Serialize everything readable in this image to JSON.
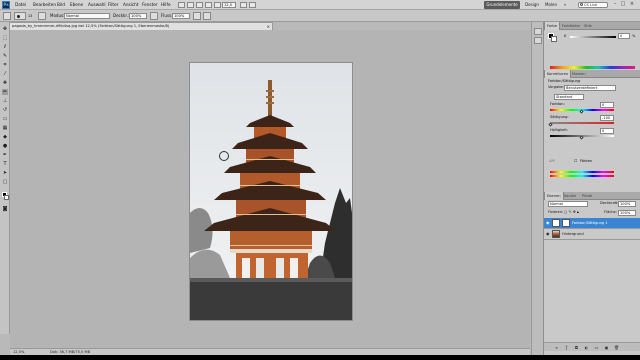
{
  "app": {
    "logo": "Ps"
  },
  "menu": {
    "items": [
      "Datei",
      "Bearbeiten",
      "Bild",
      "Ebene",
      "Auswahl",
      "Filter",
      "Ansicht",
      "Fenster",
      "Hilfe"
    ],
    "zoom": "12,5",
    "workspaces": {
      "active": "Grundelemente",
      "design": "Design",
      "paint": "Malen"
    },
    "search_placeholder": "CS Live"
  },
  "options_bar": {
    "mode_label": "Modus:",
    "mode_value": "Normal",
    "opacity_label": "Deckkr.:",
    "opacity_value": "100%",
    "flow_label": "Fluss:",
    "flow_value": "100%",
    "brush_size": "13"
  },
  "document": {
    "tab_title": "pagoda_by_hmmmmm-d9ib4sq.jpg bei 12,5% (Farbton/Sättigung 1, Ebenenmaske/8)",
    "close": "×"
  },
  "status": {
    "zoom": "12,5%",
    "doc_info": "Dok: 36,7 MB/75,5 MB"
  },
  "color_panel": {
    "tabs": [
      "Farbe",
      "Farbfelder",
      "Stile"
    ],
    "k_label": "K",
    "k_value": "0",
    "percent": "%"
  },
  "adjustments_panel": {
    "tabs": [
      "Korrekturen",
      "Masken"
    ],
    "title": "Farbton/Sättigung",
    "preset_label": "Vorgabe:",
    "preset_value": "Benutzerdefiniert",
    "channel_value": "Standard",
    "hue_label": "Farbton:",
    "hue_value": "0",
    "saturation_label": "Sättigung:",
    "saturation_value": "-100",
    "lightness_label": "Helligkeit:",
    "lightness_value": "0",
    "colorize_label": "Färben"
  },
  "layers_panel": {
    "tabs": [
      "Ebenen",
      "Kanäle",
      "Pfade"
    ],
    "blend_mode": "Normal",
    "opacity_label": "Deckkraft:",
    "opacity_value": "100%",
    "fill_label": "Fläche:",
    "fill_value": "100%",
    "lock_label": "Fixieren:",
    "layers": [
      {
        "name": "Farbton/Sättigung 1",
        "selected": true
      },
      {
        "name": "Hintergrund",
        "selected": false
      }
    ]
  },
  "colors": {
    "selection": "#3a84d2",
    "menu_bg": "#d4d4d4",
    "canvas_bg": "#b4b4b4",
    "accent_pagoda": "#b45a2a"
  }
}
